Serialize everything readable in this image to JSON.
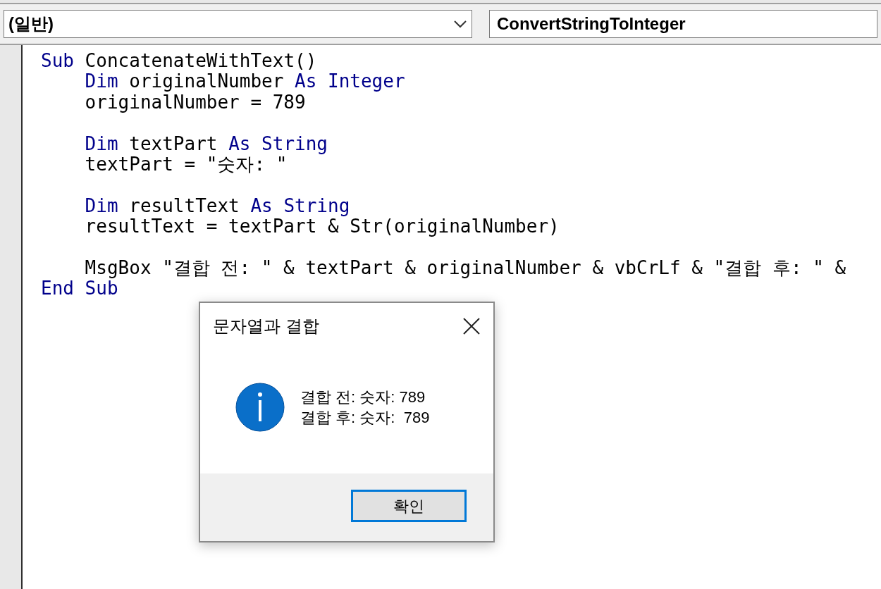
{
  "toolbar": {
    "object_box": {
      "value": "(일반)"
    },
    "procedure_box": {
      "value": "ConvertStringToInteger"
    }
  },
  "code_lines": [
    {
      "kind": "code",
      "tokens": [
        {
          "kind": "keyword",
          "text": "Sub"
        },
        {
          "kind": "plain",
          "text": " ConcatenateWithText()"
        }
      ]
    },
    {
      "kind": "code",
      "tokens": [
        {
          "kind": "keyword",
          "text": "    Dim"
        },
        {
          "kind": "plain",
          "text": " originalNumber "
        },
        {
          "kind": "keyword",
          "text": "As Integer"
        }
      ]
    },
    {
      "kind": "code",
      "tokens": [
        {
          "kind": "plain",
          "text": "    originalNumber = 789"
        }
      ]
    },
    {
      "kind": "blank"
    },
    {
      "kind": "code",
      "tokens": [
        {
          "kind": "keyword",
          "text": "    Dim"
        },
        {
          "kind": "plain",
          "text": " textPart "
        },
        {
          "kind": "keyword",
          "text": "As String"
        }
      ]
    },
    {
      "kind": "code",
      "tokens": [
        {
          "kind": "plain",
          "text": "    textPart = \"숫자: \""
        }
      ]
    },
    {
      "kind": "blank"
    },
    {
      "kind": "code",
      "tokens": [
        {
          "kind": "keyword",
          "text": "    Dim"
        },
        {
          "kind": "plain",
          "text": " resultText "
        },
        {
          "kind": "keyword",
          "text": "As String"
        }
      ]
    },
    {
      "kind": "code",
      "tokens": [
        {
          "kind": "plain",
          "text": "    resultText = textPart & Str(originalNumber)"
        }
      ]
    },
    {
      "kind": "blank"
    },
    {
      "kind": "code",
      "tokens": [
        {
          "kind": "plain",
          "text": "    MsgBox \"결합 전: \" & textPart & originalNumber & vbCrLf & \"결합 후: \" &"
        }
      ]
    },
    {
      "kind": "code",
      "tokens": [
        {
          "kind": "keyword",
          "text": "End Sub"
        }
      ]
    }
  ],
  "dialog": {
    "title": "문자열과 결합",
    "kind": "info",
    "message_lines": [
      "결합 전: 숫자: 789",
      "결합 후: 숫자:  789"
    ],
    "buttons": [
      {
        "label": "확인",
        "selected": true
      }
    ]
  }
}
